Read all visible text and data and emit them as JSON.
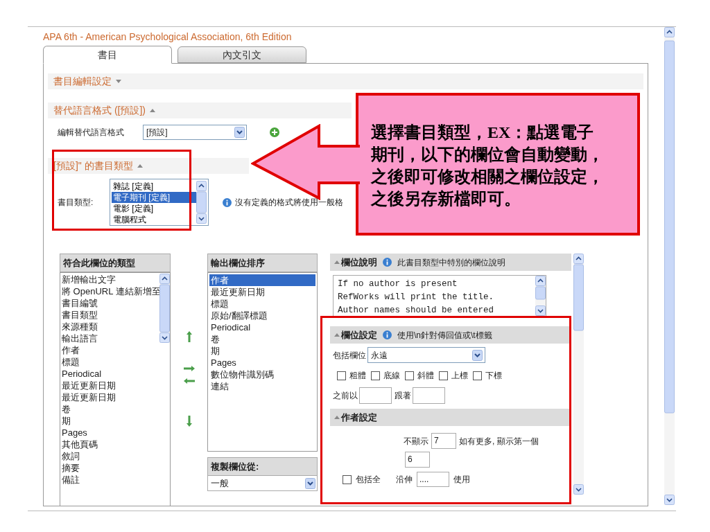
{
  "header": {
    "title": "APA 6th - American Psychological Association, 6th Edition"
  },
  "tabs": [
    {
      "label": "書目",
      "selected": true
    },
    {
      "label": "內文引文",
      "selected": false
    }
  ],
  "edit_settings": {
    "title": "書目編輯設定",
    "expanded": false
  },
  "alt_language": {
    "title": "替代語言格式 ([預設])",
    "expanded": true,
    "label": "編輯替代語言格式",
    "value": "[預設]"
  },
  "ref_types": {
    "title": "[預設]\" 的書目類型",
    "expanded": true,
    "label": "書目類型:",
    "info": "沒有定義的格式將使用一般格",
    "options": [
      {
        "label": "雜誌 [定義]",
        "selected": false
      },
      {
        "label": "電子期刊 [定義]",
        "selected": true
      },
      {
        "label": "電影 [定義]",
        "selected": false
      },
      {
        "label": "電腦程式",
        "selected": false
      }
    ]
  },
  "available_fields": {
    "title": "符合此欄位的類型",
    "items": [
      "新增輸出文字",
      "將 OpenURL 連結新增至",
      "書目編號",
      "書目類型",
      "來源種類",
      "輸出語言",
      "作者",
      "標題",
      "Periodical",
      "最近更新日期",
      "最近更新日期",
      "卷",
      "期",
      "Pages",
      "其他頁碼",
      "敘詞",
      "摘要",
      "備註"
    ]
  },
  "output_fields": {
    "title": "輸出欄位排序",
    "items": [
      {
        "label": "作者",
        "selected": true
      },
      {
        "label": "最近更新日期",
        "selected": false
      },
      {
        "label": "標題",
        "selected": false
      },
      {
        "label": "原始/翻譯標題",
        "selected": false
      },
      {
        "label": "Periodical",
        "selected": false
      },
      {
        "label": "卷",
        "selected": false
      },
      {
        "label": "期",
        "selected": false
      },
      {
        "label": "Pages",
        "selected": false
      },
      {
        "label": "數位物件識別碼",
        "selected": false
      },
      {
        "label": "連結",
        "selected": false
      }
    ]
  },
  "copy_fields": {
    "title": "複製欄位從:",
    "value": "一般"
  },
  "field_help": {
    "title": "欄位說明",
    "expanded": true,
    "note": "此書目類型中特別的欄位說明",
    "text": "If no author is present\nRefWorks will print the title.\nAuthor names should be entered"
  },
  "field_settings": {
    "title": "欄位設定",
    "expanded": true,
    "note": "使用\\n針對傳回值或\\t標籤",
    "include_label": "包括欄位",
    "include_value": "永遠",
    "styles": [
      {
        "label": "粗體",
        "checked": false
      },
      {
        "label": "底線",
        "checked": false
      },
      {
        "label": "斜體",
        "checked": false
      },
      {
        "label": "上標",
        "checked": false
      },
      {
        "label": "下標",
        "checked": false
      }
    ],
    "prefix_label": "之前以",
    "suffix_label": "跟著"
  },
  "author_settings": {
    "title": "作者設定",
    "expanded": true,
    "hide_label": "不顯示",
    "hide_value": "7",
    "more_label": "如有更多, 顯示第一個",
    "first_value": "6",
    "include_all": {
      "label": "包括全",
      "checked": false
    },
    "extend_label": "沿伸",
    "extend_value": "....",
    "use_label": "使用"
  },
  "callout": {
    "text": "選擇書目類型，EX：點選電子期刊，以下的欄位會自動變動，之後即可修改相關之欄位設定，之後另存新檔即可。"
  }
}
